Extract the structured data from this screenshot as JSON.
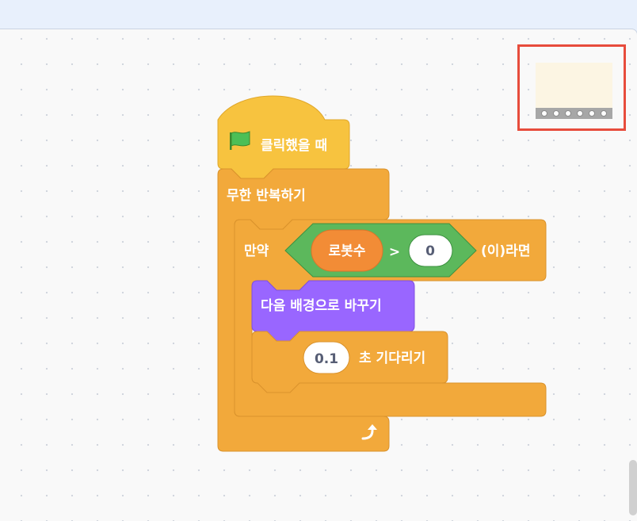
{
  "event_block": {
    "label": "클릭했을 때",
    "icon": "green-flag-icon",
    "color": "#f7c33f"
  },
  "forever_block": {
    "label": "무한 반복하기",
    "loop_icon": "loop-arrow-icon",
    "color": "#f2a93b"
  },
  "if_block": {
    "label_if": "만약",
    "label_then": "(이)라면",
    "condition": {
      "operator": ">",
      "left_reporter": "로봇수",
      "right_value": "0",
      "color": "#5cb85c"
    }
  },
  "looks_block": {
    "label": "다음 배경으로 바꾸기",
    "color": "#9966ff"
  },
  "wait_block": {
    "value": "0.1",
    "label": "초 기다리기"
  },
  "sprite_thumbnail": {
    "icon": "sprite-costume-icon"
  },
  "colors": {
    "variable": "#f28c36",
    "highlight": "#e74c3c"
  }
}
